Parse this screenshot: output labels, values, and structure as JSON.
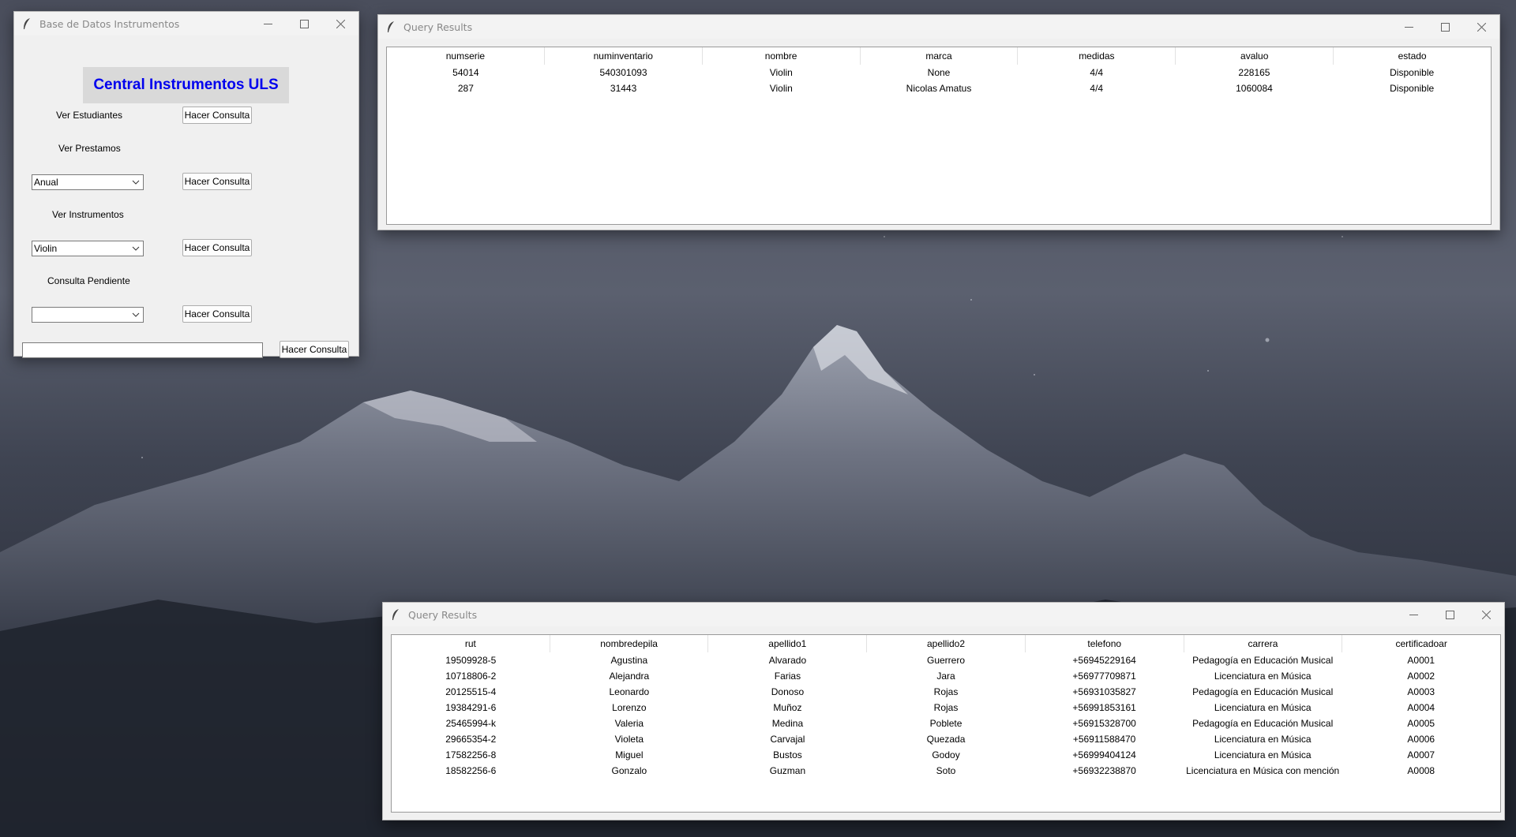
{
  "main_window": {
    "title": "Base de Datos Instrumentos",
    "header": "Central Instrumentos ULS",
    "ver_estudiantes_label": "Ver Estudiantes",
    "ver_prestamos_label": "Ver Prestamos",
    "ver_instrumentos_label": "Ver Instrumentos",
    "consulta_pendiente_label": "Consulta Pendiente",
    "button_label": "Hacer Consulta",
    "prestamos_select_value": "Anual",
    "instrumentos_select_value": "Violin",
    "pendiente_select_value": "",
    "query_entry_value": ""
  },
  "instruments_window": {
    "title": "Query Results",
    "columns": [
      "numserie",
      "numinventario",
      "nombre",
      "marca",
      "medidas",
      "avaluo",
      "estado"
    ],
    "rows": [
      [
        "54014",
        "540301093",
        "Violin",
        "None",
        "4/4",
        "228165",
        "Disponible"
      ],
      [
        "287",
        "31443",
        "Violin",
        "Nicolas Amatus",
        "4/4",
        "1060084",
        "Disponible"
      ]
    ]
  },
  "students_window": {
    "title": "Query Results",
    "columns": [
      "rut",
      "nombredepila",
      "apellido1",
      "apellido2",
      "telefono",
      "carrera",
      "certificadoar"
    ],
    "rows": [
      [
        "19509928-5",
        "Agustina",
        "Alvarado",
        "Guerrero",
        "+56945229164",
        "Pedagogía en Educación Musical",
        "A0001"
      ],
      [
        "10718806-2",
        "Alejandra",
        "Farias",
        "Jara",
        "+56977709871",
        "Licenciatura en Música",
        "A0002"
      ],
      [
        "20125515-4",
        "Leonardo",
        "Donoso",
        "Rojas",
        "+56931035827",
        "Pedagogía en Educación Musical",
        "A0003"
      ],
      [
        "19384291-6",
        "Lorenzo",
        "Muñoz",
        "Rojas",
        "+56991853161",
        "Licenciatura en Música",
        "A0004"
      ],
      [
        "25465994-k",
        "Valeria",
        "Medina",
        "Poblete",
        "+56915328700",
        "Pedagogía en Educación Musical",
        "A0005"
      ],
      [
        "29665354-2",
        "Violeta",
        "Carvajal",
        "Quezada",
        "+56911588470",
        "Licenciatura en Música",
        "A0006"
      ],
      [
        "17582256-8",
        "Miguel",
        "Bustos",
        "Godoy",
        "+56999404124",
        "Licenciatura en Música",
        "A0007"
      ],
      [
        "18582256-6",
        "Gonzalo",
        "Guzman",
        "Soto",
        "+56932238870",
        "Licenciatura en Música con mención",
        "A0008"
      ]
    ]
  }
}
